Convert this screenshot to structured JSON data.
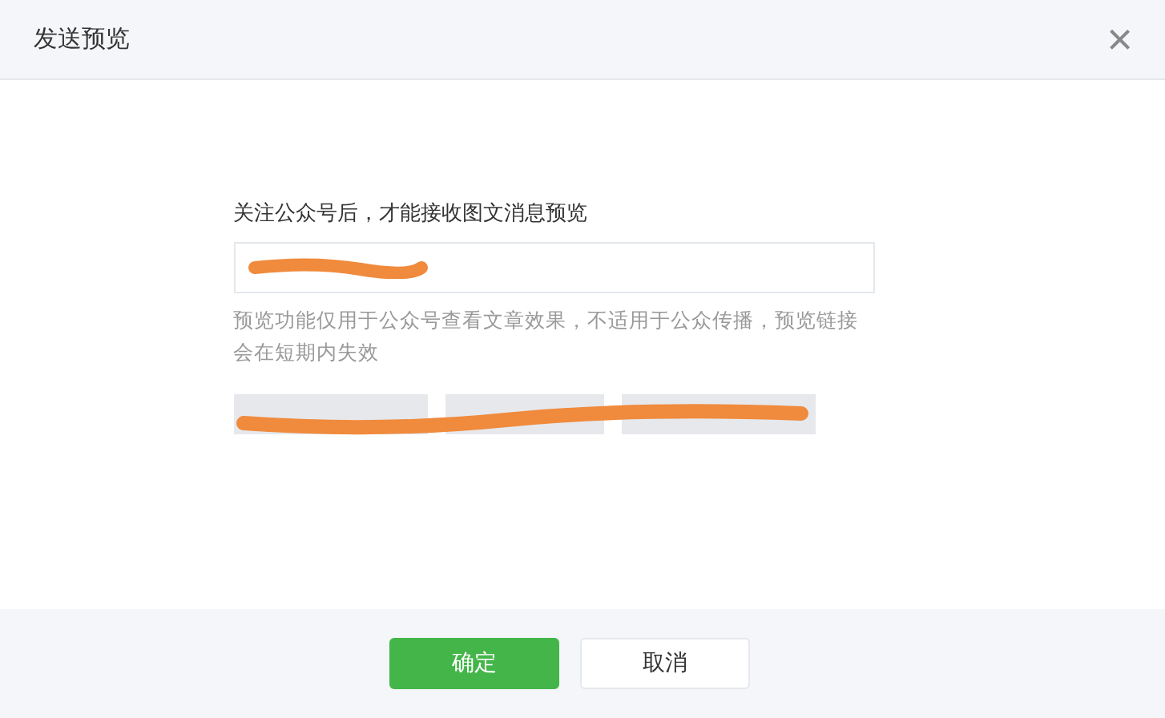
{
  "dialog": {
    "title": "发送预览",
    "close": "×"
  },
  "form": {
    "label": "关注公众号后，才能接收图文消息预览",
    "input": {
      "kind": "redacted"
    },
    "hint": "预览功能仅用于公众号查看文章效果，不适用于公众传播，预览链接会在短期内失效",
    "recent": [
      {
        "kind": "redacted"
      },
      {
        "kind": "redacted"
      },
      {
        "kind": "redacted"
      }
    ]
  },
  "buttons": [
    {
      "label": "确定",
      "kind": "primary"
    },
    {
      "label": "取消",
      "kind": "default"
    }
  ]
}
